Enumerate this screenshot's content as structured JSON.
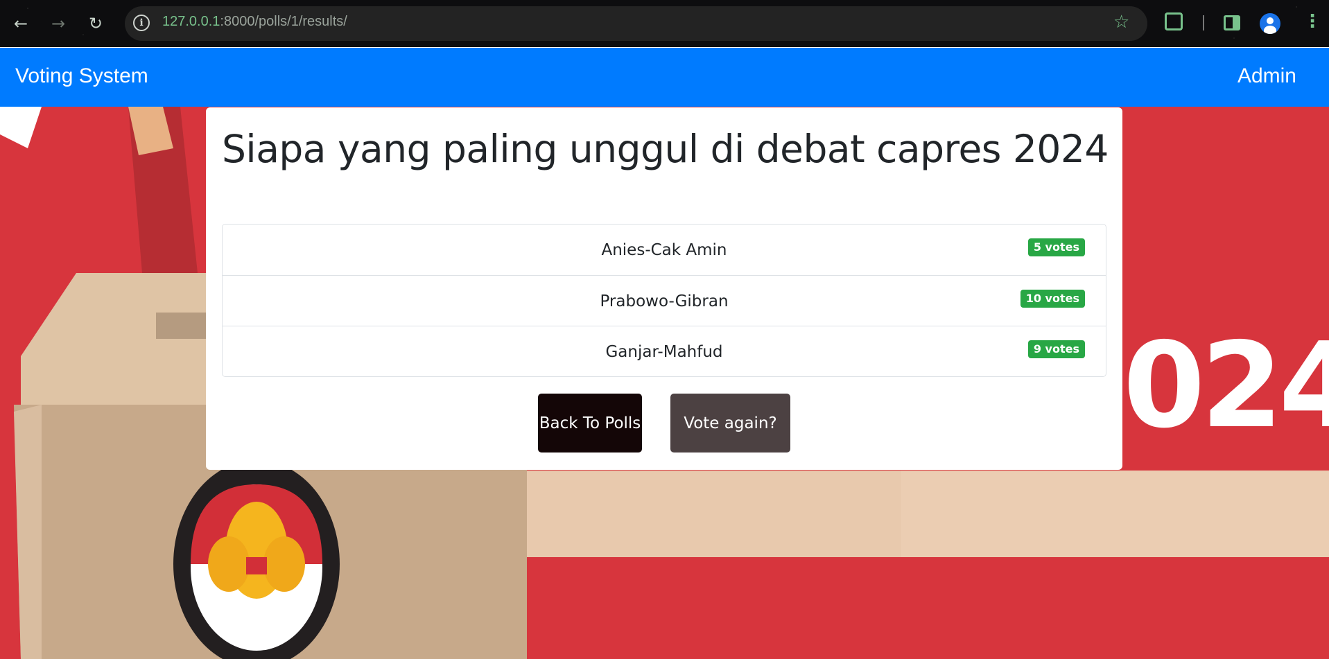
{
  "browser": {
    "url_host": "127.0.0.1",
    "url_rest": ":8000/polls/1/results/"
  },
  "navbar": {
    "brand": "Voting System",
    "admin_link": "Admin"
  },
  "background": {
    "banner_text": "024"
  },
  "poll": {
    "question": "Siapa yang paling unggul di debat capres 2024",
    "results": [
      {
        "choice": "Anies-Cak Amin",
        "votes": "5 votes"
      },
      {
        "choice": "Prabowo-Gibran",
        "votes": "10 votes"
      },
      {
        "choice": "Ganjar-Mahfud",
        "votes": "9 votes"
      }
    ],
    "back_button": "Back To Polls",
    "vote_again_button": "Vote again?"
  },
  "colors": {
    "navbar": "#007bff",
    "badge": "#28a745",
    "back_button": "#140607",
    "vote_again_button": "#4c4142"
  }
}
